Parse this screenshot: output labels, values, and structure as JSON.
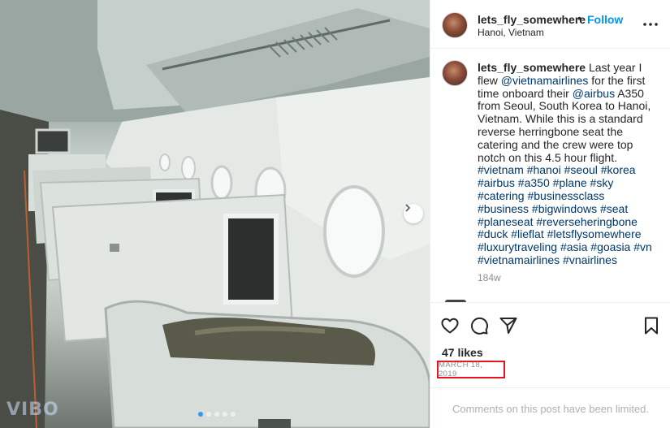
{
  "post": {
    "username": "lets_fly_somewhere",
    "separator": "•",
    "follow_label": "Follow",
    "location": "Hanoi, Vietnam",
    "more_icon": "more-horizontal-icon"
  },
  "caption": {
    "username": "lets_fly_somewhere",
    "segments": [
      {
        "text": "Last year I flew ",
        "tag": false
      },
      {
        "text": "@vietnamairlines",
        "tag": true
      },
      {
        "text": " for the first time onboard their ",
        "tag": false
      },
      {
        "text": "@airbus",
        "tag": true
      },
      {
        "text": " A350 from Seoul, South Korea to Hanoi, Vietnam. While this is a standard reverse herringbone seat the catering and the crew were top notch on this 4.5 hour flight. ",
        "tag": false
      },
      {
        "text": "#vietnam #hanoi #seoul #korea #airbus #a350 #plane #sky #catering #businessclass #business #bigwindows #seat #planeseat #reverseheringbone #duck #lieflat #letsflysomewhere #luxurytraveling #asia #goasia #vn #vietnamairlines #vnairlines",
        "tag": true
      }
    ],
    "age": "184w"
  },
  "actions": {
    "icons": [
      "heart-icon",
      "comment-icon",
      "share-icon",
      "bookmark-icon"
    ],
    "likes": "47 likes",
    "date": "MARCH 18, 2019",
    "date_highlight_color": "#e8141b"
  },
  "comments": {
    "limited_text": "Comments on this post have been limited."
  },
  "media": {
    "description_icon": "next-arrow-icon",
    "carousel_count": 5,
    "carousel_active": 0,
    "watermark": "VIBO"
  },
  "colors": {
    "link": "#0095f6",
    "hashtag": "#00376b",
    "muted": "#8e8e8e"
  }
}
